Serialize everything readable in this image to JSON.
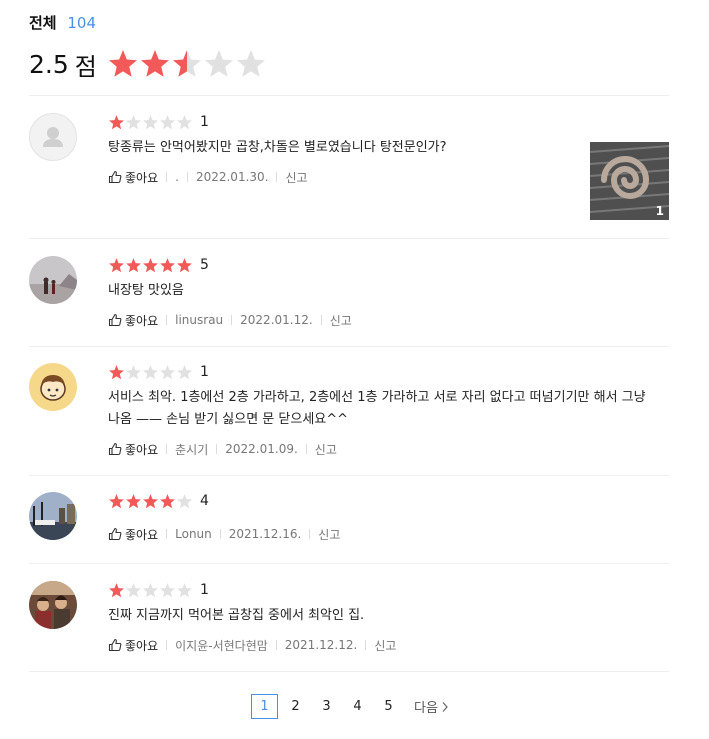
{
  "summary": {
    "total_label": "전체",
    "total_count": "104",
    "score": "2.5",
    "score_unit": "점",
    "rating": 2.5
  },
  "reviews": [
    {
      "rating": 1,
      "rating_label": "1",
      "text": "탕종류는 안먹어봤지만 곱창,차돌은 별로였습니다 탕전문인가?",
      "like": "좋아요",
      "user": ".",
      "date": "2022.01.30.",
      "report": "신고",
      "photo_count": "1"
    },
    {
      "rating": 5,
      "rating_label": "5",
      "text": "내장탕 맛있음",
      "like": "좋아요",
      "user": "linusrau",
      "date": "2022.01.12.",
      "report": "신고"
    },
    {
      "rating": 1,
      "rating_label": "1",
      "text": "서비스 최악. 1층에선 2층 가라하고, 2층에선 1층 가라하고 서로 자리 없다고 떠넘기기만 해서 그냥 나옴 ——  손님 받기 싫으면 문 닫으세요^^",
      "like": "좋아요",
      "user": "춘시기",
      "date": "2022.01.09.",
      "report": "신고"
    },
    {
      "rating": 4,
      "rating_label": "4",
      "text": "",
      "like": "좋아요",
      "user": "Lonun",
      "date": "2021.12.16.",
      "report": "신고"
    },
    {
      "rating": 1,
      "rating_label": "1",
      "text": "진짜 지금까지 먹어본 곱창집 중에서 최악인 집.",
      "like": "좋아요",
      "user": "이지윤-서현다현맘",
      "date": "2021.12.12.",
      "report": "신고"
    }
  ],
  "pagination": {
    "pages": [
      "1",
      "2",
      "3",
      "4",
      "5"
    ],
    "current": "1",
    "next_label": "다음"
  },
  "colors": {
    "star_on": "#f25a5a",
    "star_off": "#e1e1e1",
    "accent": "#4a90e2"
  }
}
